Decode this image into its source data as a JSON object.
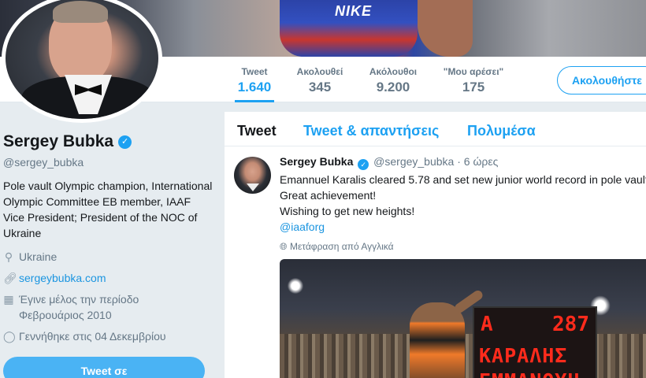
{
  "banner": {
    "shirt_text": "NIKE"
  },
  "nav": {
    "stats": [
      {
        "label": "Tweet",
        "value": "1.640"
      },
      {
        "label": "Ακολουθεί",
        "value": "345"
      },
      {
        "label": "Ακόλουθοι",
        "value": "9.200"
      },
      {
        "label": "\"Μου αρέσει\"",
        "value": "175"
      }
    ],
    "follow_button": "Ακολουθήστε"
  },
  "profile": {
    "name": "Sergey Bubka",
    "verified_icon": "verified-badge-icon",
    "handle": "@sergey_bubka",
    "bio": "Pole vault Olympic champion, International Olympic Committee EB member, IAAF Vice President; President of the NOC of Ukraine",
    "location": "Ukraine",
    "website": "sergeybubka.com",
    "joined_line1": "Έγινε μέλος την περίοδο",
    "joined_line2": "Φεβρουάριος 2010",
    "birthday": "Γεννήθηκε στις 04 Δεκεμβρίου",
    "tweet_to_button": "Tweet σε"
  },
  "timeline": {
    "tabs": [
      "Tweet",
      "Tweet & απαντήσεις",
      "Πολυμέσα"
    ],
    "tweet": {
      "name": "Sergey Bubka",
      "handle": "@sergey_bubka",
      "time": "· 6 ώρες",
      "lines": [
        "Emannuel Karalis cleared 5.78 and set new junior world record in pole vault!",
        "Great achievement!",
        "Wishing to get new heights!"
      ],
      "mention": "@iaaforg",
      "translate": "Μετάφραση από Αγγλικά"
    },
    "media_board": {
      "letter": "Α",
      "number": "287",
      "line1": "ΚΑΡΑΛΗΣ",
      "line2": "ΕΜΜΑΝΟΥΗ"
    }
  },
  "colors": {
    "accent": "#1da1f2",
    "link": "#1b95e0",
    "background": "#e6ecf0"
  }
}
